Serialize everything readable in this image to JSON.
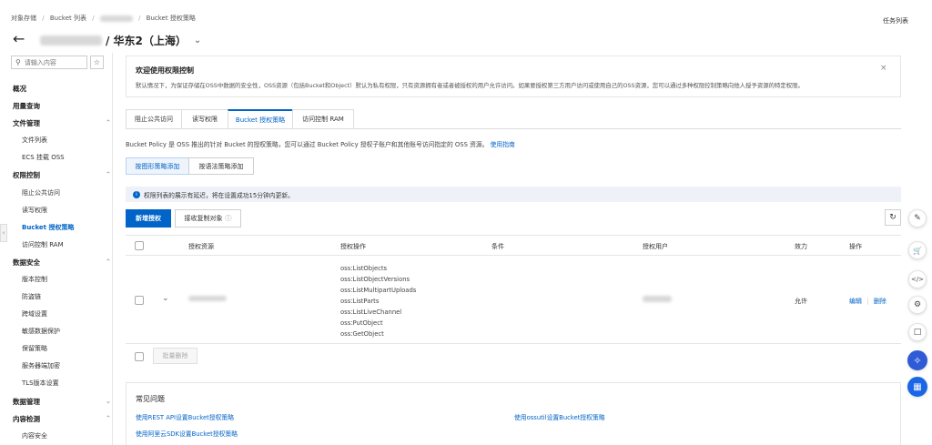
{
  "breadcrumb": {
    "root": "对象存储",
    "list": "Bucket 列表",
    "sep": "/",
    "current": "Bucket 授权策略"
  },
  "header": {
    "region": "/ 华东2（上海）",
    "task_list": "任务列表"
  },
  "sidebar": {
    "search_placeholder": "请输入内容",
    "overview": "概况",
    "usage": "用量查询",
    "file_mgmt": "文件管理",
    "file_list": "文件列表",
    "ecs_mount": "ECS 挂载 OSS",
    "perm_ctrl": "权限控制",
    "block_public": "阻止公共访问",
    "rw_perm": "读写权限",
    "bucket_policy": "Bucket 授权策略",
    "access_ram": "访问控制 RAM",
    "data_security": "数据安全",
    "versioning": "版本控制",
    "hotlink": "防盗链",
    "cors": "跨域设置",
    "sensitive": "敏感数据保护",
    "retention": "保留策略",
    "sse": "服务器端加密",
    "tls": "TLS版本设置",
    "data_mgmt": "数据管理",
    "content_detect": "内容检测",
    "content_security": "内容安全"
  },
  "notice": {
    "title": "欢迎使用权限控制",
    "body": "默认情况下，为保证存储在OSS中数据的安全性，OSS资源（包括Bucket和Object）默认为私有权限，只有资源拥有者或者被授权的用户允许访问。如果要授权第三方用户访问或使用自己的OSS资源，您可以通过多种权限控制策略向他人授予资源的特定权限。"
  },
  "tabs": [
    "阻止公共访问",
    "读写权限",
    "Bucket 授权策略",
    "访问控制 RAM"
  ],
  "desc": {
    "text": "Bucket Policy 是 OSS 推出的针对 Bucket 的授权策略，您可以通过 Bucket Policy 授权子账户和其他账号访问指定的 OSS 资源。",
    "link": "使用指南"
  },
  "mode_tabs": [
    "按图形策略添加",
    "按语法策略添加"
  ],
  "info": "权限列表的展示有延迟，将在设置成功15分钟内更新。",
  "actions": {
    "add": "新增授权",
    "copy": "接收复制对象"
  },
  "table": {
    "headers": {
      "resource": "授权资源",
      "operation": "授权操作",
      "condition": "条件",
      "user": "授权用户",
      "effect": "效力",
      "ops": "操作"
    },
    "row": {
      "operations": [
        "oss:ListObjects",
        "oss:ListObjectVersions",
        "oss:ListMultipartUploads",
        "oss:ListParts",
        "oss:ListLiveChannel",
        "oss:PutObject",
        "oss:GetObject"
      ],
      "effect": "允许",
      "edit": "编辑",
      "delete": "删除"
    },
    "bulk_delete": "批量删除"
  },
  "faq": {
    "title": "常见问题",
    "links": [
      "使用REST API设置Bucket授权策略",
      "使用ossutil设置Bucket授权策略",
      "使用阿里云SDK设置Bucket授权策略"
    ]
  },
  "colors": {
    "primary": "#0064c8",
    "notice_bg": "#ffffff",
    "info_bg": "#eef2f8"
  }
}
